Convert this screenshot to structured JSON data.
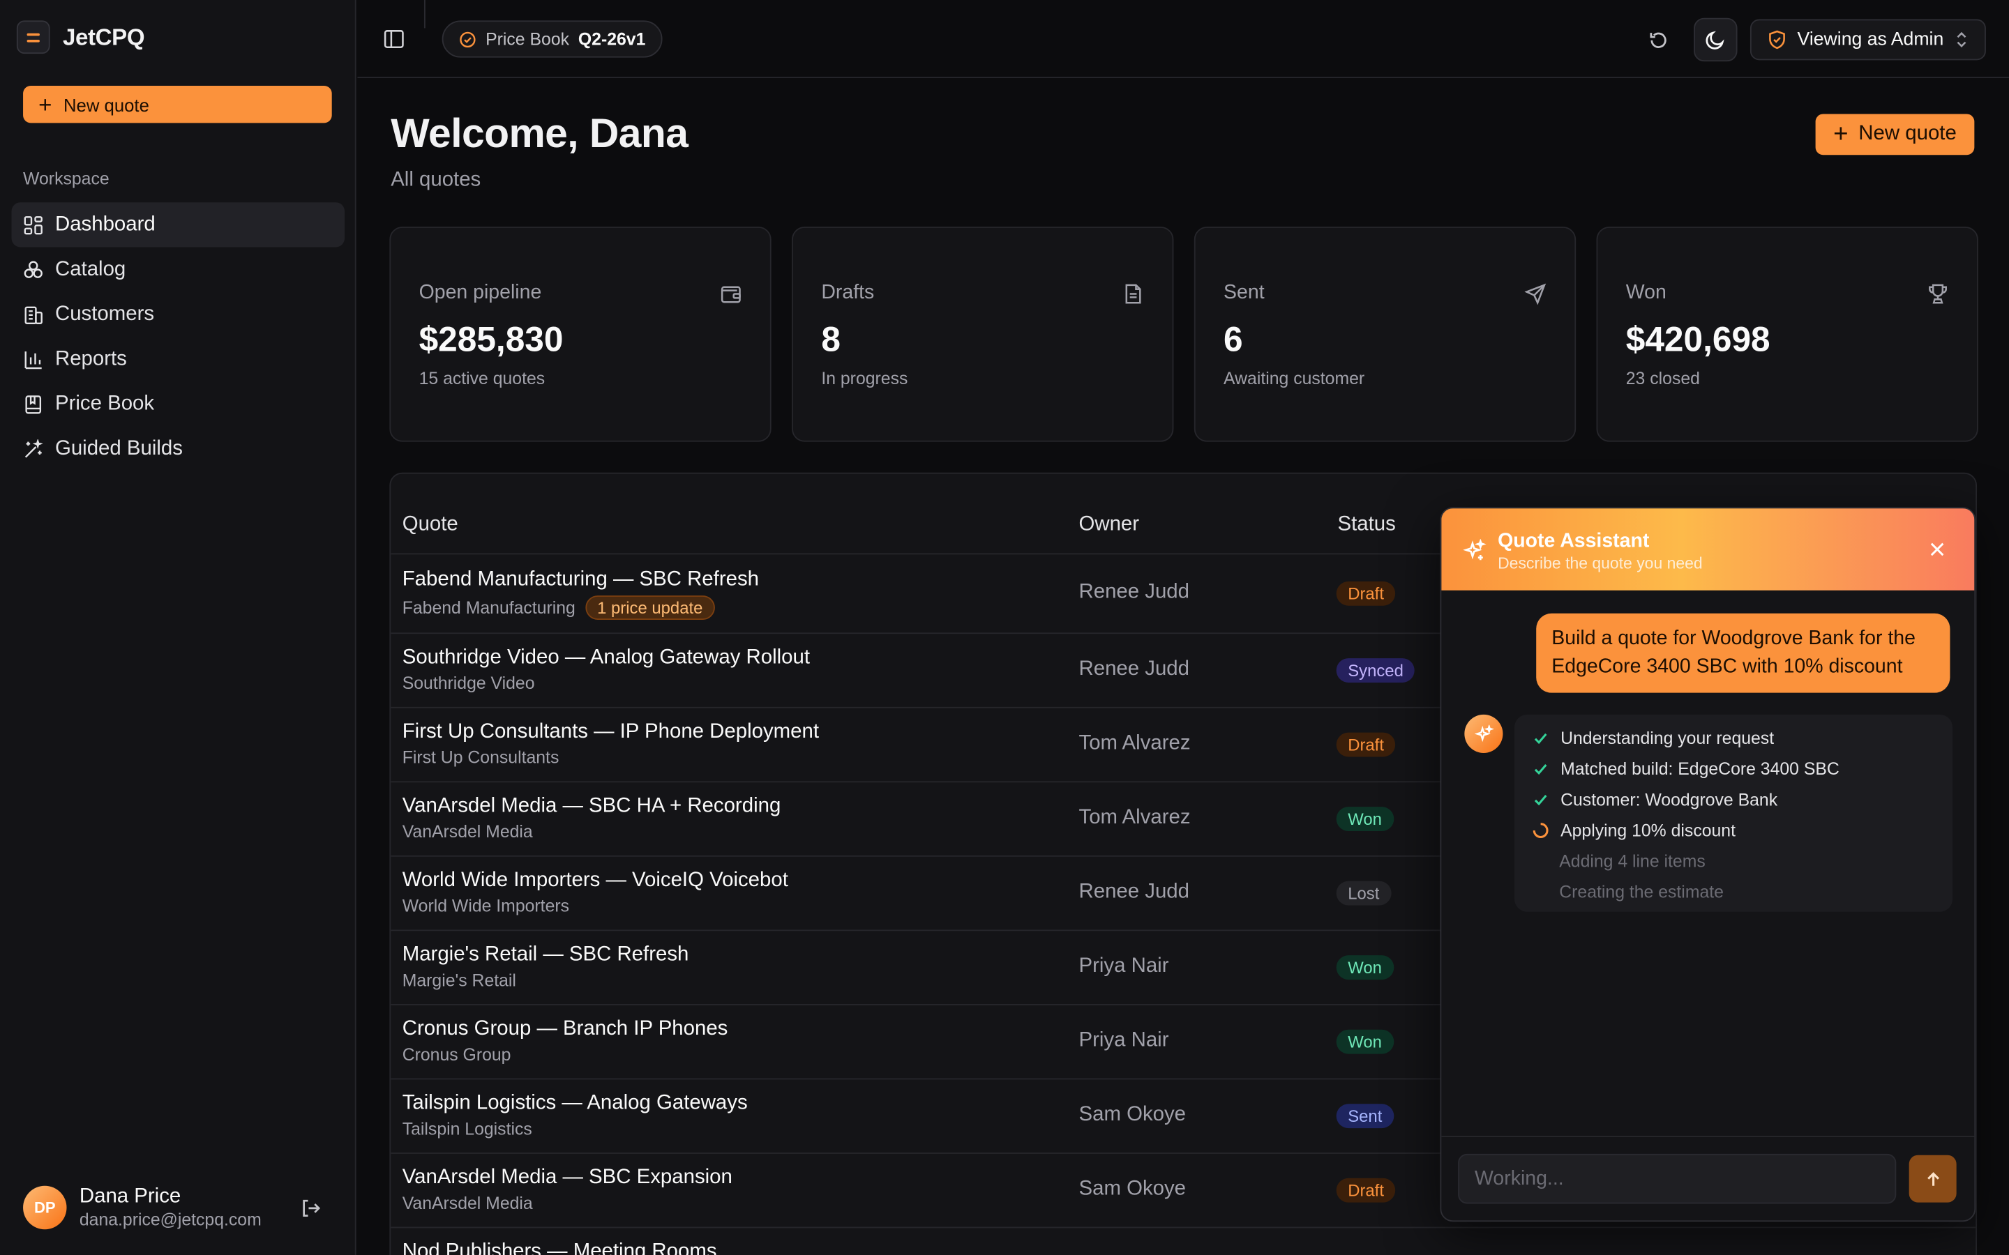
{
  "app": {
    "name": "JetCPQ"
  },
  "sidebar": {
    "new_quote_label": "New quote",
    "section_label": "Workspace",
    "items": [
      {
        "label": "Dashboard",
        "icon": "dashboard-icon"
      },
      {
        "label": "Catalog",
        "icon": "catalog-icon"
      },
      {
        "label": "Customers",
        "icon": "customers-icon"
      },
      {
        "label": "Reports",
        "icon": "reports-icon"
      },
      {
        "label": "Price Book",
        "icon": "price-book-icon"
      },
      {
        "label": "Guided Builds",
        "icon": "wand-icon"
      }
    ],
    "user": {
      "initials": "DP",
      "name": "Dana Price",
      "email": "dana.price@jetcpq.com"
    }
  },
  "topbar": {
    "pricebook_label": "Price Book",
    "pricebook_version": "Q2-26v1",
    "viewing_label": "Viewing as Admin"
  },
  "header": {
    "title": "Welcome, Dana",
    "subtitle": "All quotes",
    "new_quote_label": "New quote"
  },
  "stats": [
    {
      "label": "Open pipeline",
      "value": "$285,830",
      "sub": "15 active quotes",
      "icon": "wallet-icon"
    },
    {
      "label": "Drafts",
      "value": "8",
      "sub": "In progress",
      "icon": "document-icon"
    },
    {
      "label": "Sent",
      "value": "6",
      "sub": "Awaiting customer",
      "icon": "send-icon"
    },
    {
      "label": "Won",
      "value": "$420,698",
      "sub": "23 closed",
      "icon": "trophy-icon"
    }
  ],
  "table": {
    "columns": {
      "quote": "Quote",
      "owner": "Owner",
      "status": "Status"
    },
    "rows": [
      {
        "title": "Fabend Manufacturing — SBC Refresh",
        "customer": "Fabend Manufacturing",
        "badge": "1 price update",
        "owner": "Renee Judd",
        "status": "Draft"
      },
      {
        "title": "Southridge Video — Analog Gateway Rollout",
        "customer": "Southridge Video",
        "owner": "Renee Judd",
        "status": "Synced"
      },
      {
        "title": "First Up Consultants — IP Phone Deployment",
        "customer": "First Up Consultants",
        "owner": "Tom Alvarez",
        "status": "Draft"
      },
      {
        "title": "VanArsdel Media — SBC HA + Recording",
        "customer": "VanArsdel Media",
        "owner": "Tom Alvarez",
        "status": "Won"
      },
      {
        "title": "World Wide Importers — VoiceIQ Voicebot",
        "customer": "World Wide Importers",
        "owner": "Renee Judd",
        "status": "Lost"
      },
      {
        "title": "Margie's Retail — SBC Refresh",
        "customer": "Margie's Retail",
        "owner": "Priya Nair",
        "status": "Won"
      },
      {
        "title": "Cronus Group — Branch IP Phones",
        "customer": "Cronus Group",
        "owner": "Priya Nair",
        "status": "Won"
      },
      {
        "title": "Tailspin Logistics — Analog Gateways",
        "customer": "Tailspin Logistics",
        "owner": "Sam Okoye",
        "status": "Sent"
      },
      {
        "title": "VanArsdel Media — SBC Expansion",
        "customer": "VanArsdel Media",
        "owner": "Sam Okoye",
        "status": "Draft"
      },
      {
        "title": "Nod Publishers — Meeting Rooms",
        "customer": "",
        "owner": "",
        "status": ""
      }
    ]
  },
  "assistant": {
    "title": "Quote Assistant",
    "subtitle": "Describe the quote you need",
    "user_message": "Build a quote for Woodgrove Bank for the EdgeCore 3400 SBC with 10% discount",
    "steps": [
      {
        "label": "Understanding your request",
        "state": "done"
      },
      {
        "label": "Matched build: EdgeCore 3400 SBC",
        "state": "done"
      },
      {
        "label": "Customer: Woodgrove Bank",
        "state": "done"
      },
      {
        "label": "Applying 10% discount",
        "state": "running"
      },
      {
        "label": "Adding 4 line items",
        "state": "pending"
      },
      {
        "label": "Creating the estimate",
        "state": "pending"
      }
    ],
    "input_placeholder": "Working..."
  },
  "colors": {
    "accent": "#fb923c",
    "background": "#0c0c0e",
    "panel": "#141417"
  }
}
